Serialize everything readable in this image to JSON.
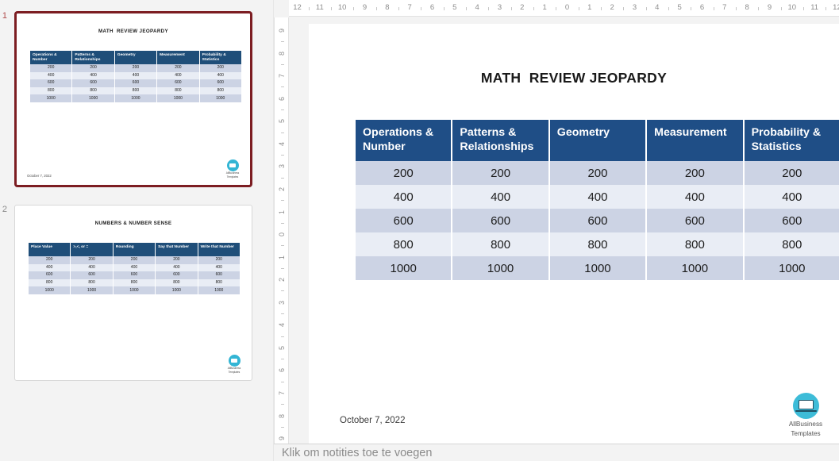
{
  "app": {
    "ui_language": "nl",
    "selection_border_color": "#7c1d22",
    "table_header_color": "#1f4e86",
    "band_a_color": "#ccd3e4",
    "band_b_color": "#e9edf5"
  },
  "rulers": {
    "horizontal": [
      "12",
      "11",
      "10",
      "9",
      "8",
      "7",
      "6",
      "5",
      "4",
      "3",
      "2",
      "1",
      "0",
      "1",
      "2",
      "3",
      "4",
      "5",
      "6",
      "7",
      "8",
      "9",
      "10",
      "11",
      "12"
    ],
    "vertical": [
      "9",
      "8",
      "7",
      "6",
      "5",
      "4",
      "3",
      "2",
      "1",
      "0",
      "1",
      "2",
      "3",
      "4",
      "5",
      "6",
      "7",
      "8",
      "9"
    ]
  },
  "thumbnails": [
    {
      "number": "1",
      "selected": true,
      "title": "MATH  REVIEW JEOPARDY",
      "columns": [
        "Operations & Number",
        "Patterns & Relationships",
        "Geometry",
        "Measurement",
        "Probability & Statistics"
      ],
      "rows": [
        [
          "200",
          "200",
          "200",
          "200",
          "200"
        ],
        [
          "400",
          "400",
          "400",
          "400",
          "400"
        ],
        [
          "600",
          "600",
          "600",
          "600",
          "600"
        ],
        [
          "800",
          "800",
          "800",
          "800",
          "800"
        ],
        [
          "1000",
          "1000",
          "1000",
          "1000",
          "1000"
        ]
      ],
      "date": "October 7, 2022",
      "logo_line1": "AllBusiness",
      "logo_line2": "Templates"
    },
    {
      "number": "2",
      "selected": false,
      "title": "NUMBERS & NUMBER SENSE",
      "columns": [
        "Place Value",
        ">,<, or =",
        "Rounding",
        "Say that Number",
        "Write that Number"
      ],
      "rows": [
        [
          "200",
          "200",
          "200",
          "200",
          "200"
        ],
        [
          "400",
          "400",
          "400",
          "400",
          "400"
        ],
        [
          "600",
          "600",
          "600",
          "600",
          "600"
        ],
        [
          "800",
          "800",
          "800",
          "800",
          "800"
        ],
        [
          "1000",
          "1000",
          "1000",
          "1000",
          "1000"
        ]
      ],
      "date": "",
      "logo_line1": "AllBusiness",
      "logo_line2": "Templates"
    }
  ],
  "slide": {
    "title": "MATH  REVIEW JEOPARDY",
    "columns": [
      "Operations & Number",
      "Patterns & Relationships",
      "Geometry",
      "Measurement",
      "Probability & Statistics"
    ],
    "rows": [
      [
        "200",
        "200",
        "200",
        "200",
        "200"
      ],
      [
        "400",
        "400",
        "400",
        "400",
        "400"
      ],
      [
        "600",
        "600",
        "600",
        "600",
        "600"
      ],
      [
        "800",
        "800",
        "800",
        "800",
        "800"
      ],
      [
        "1000",
        "1000",
        "1000",
        "1000",
        "1000"
      ]
    ],
    "date": "October 7, 2022",
    "logo_line1": "AllBusiness",
    "logo_line2": "Templates"
  },
  "notes": {
    "placeholder": "Klik om notities toe te voegen"
  }
}
